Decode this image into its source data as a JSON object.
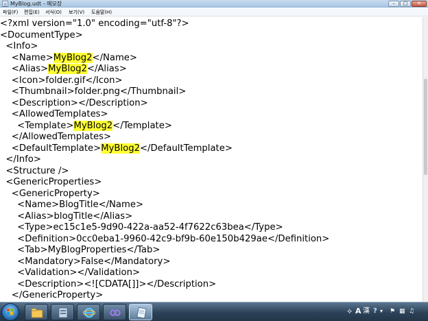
{
  "window": {
    "title": "MyBlog.udt - 메모장",
    "minimize_glyph": "–",
    "maximize_glyph": "□",
    "close_glyph": "✕"
  },
  "menu": [
    "파일(F)",
    "편집(E)",
    "서식(O)",
    "보기(V)",
    "도움말(H)"
  ],
  "highlight_color": "#ffff33",
  "lines": [
    [
      {
        "t": "<?xml version=\"1.0\" encoding=\"utf-8\"?>"
      }
    ],
    [
      {
        "t": "<DocumentType>"
      }
    ],
    [
      {
        "t": "  <Info>"
      }
    ],
    [
      {
        "t": "    <Name>"
      },
      {
        "t": "MyBlog2",
        "hl": true
      },
      {
        "t": "</Name>"
      }
    ],
    [
      {
        "t": "    <Alias>"
      },
      {
        "t": "MyBlog2",
        "hl": true
      },
      {
        "t": "</Alias>"
      }
    ],
    [
      {
        "t": "    <Icon>folder.gif</Icon>"
      }
    ],
    [
      {
        "t": "    <Thumbnail>folder.png</Thumbnail>"
      }
    ],
    [
      {
        "t": "    <Description></Description>"
      }
    ],
    [
      {
        "t": "    <AllowedTemplates>"
      }
    ],
    [
      {
        "t": "      <Template>"
      },
      {
        "t": "MyBlog2",
        "hl": true
      },
      {
        "t": "</Template>"
      }
    ],
    [
      {
        "t": "    </AllowedTemplates>"
      }
    ],
    [
      {
        "t": "    <DefaultTemplate>"
      },
      {
        "t": "MyBlog2",
        "hl": true
      },
      {
        "t": "</DefaultTemplate>"
      }
    ],
    [
      {
        "t": "  </Info>"
      }
    ],
    [
      {
        "t": "  <Structure />"
      }
    ],
    [
      {
        "t": "  <GenericProperties>"
      }
    ],
    [
      {
        "t": "    <GenericProperty>"
      }
    ],
    [
      {
        "t": "      <Name>BlogTitle</Name>"
      }
    ],
    [
      {
        "t": "      <Alias>blogTitle</Alias>"
      }
    ],
    [
      {
        "t": "      <Type>ec15c1e5-9d90-422a-aa52-4f7622c63bea</Type>"
      }
    ],
    [
      {
        "t": "      <Definition>0cc0eba1-9960-42c9-bf9b-60e150b429ae</Definition>"
      }
    ],
    [
      {
        "t": "      <Tab>MyBlogProperties</Tab>"
      }
    ],
    [
      {
        "t": "      <Mandatory>False</Mandatory>"
      }
    ],
    [
      {
        "t": "      <Validation></Validation>"
      }
    ],
    [
      {
        "t": "      <Description><![CDATA[]]></Description>"
      }
    ],
    [
      {
        "t": "    </GenericProperty>"
      }
    ]
  ],
  "taskbar": {
    "buttons": [
      {
        "name": "explorer-folder-icon"
      },
      {
        "name": "server-manager-icon"
      },
      {
        "name": "internet-explorer-icon"
      },
      {
        "name": "visual-studio-icon"
      },
      {
        "name": "notepad-icon",
        "active": true
      }
    ],
    "tray": {
      "ime_label": "A",
      "ime_mode": "漢",
      "help": "?",
      "clock": ""
    }
  }
}
